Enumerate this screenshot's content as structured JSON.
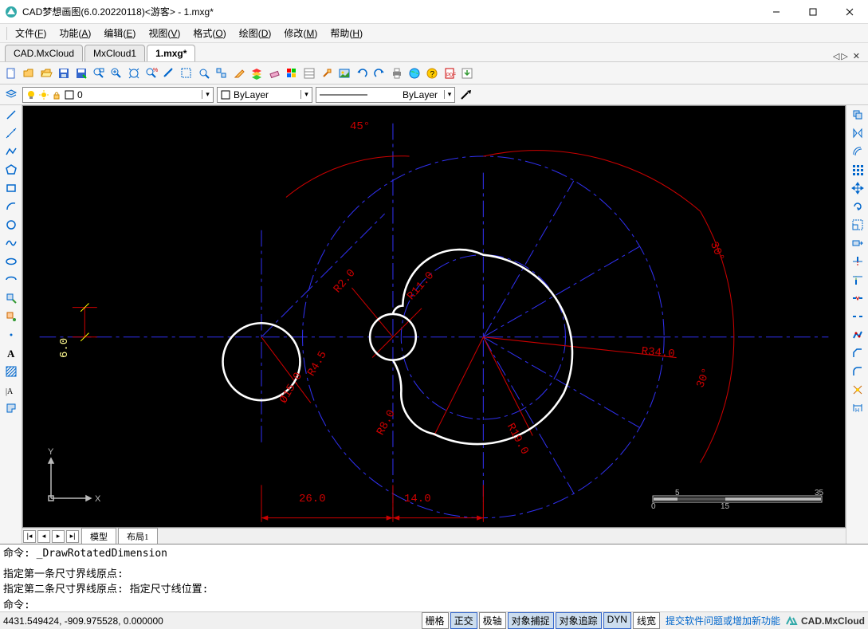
{
  "title": "CAD梦想画图(6.0.20220118)<游客> -  1.mxg*",
  "menus": [
    {
      "label": "文件",
      "key": "F"
    },
    {
      "label": "功能",
      "key": "A"
    },
    {
      "label": "编辑",
      "key": "E"
    },
    {
      "label": "视图",
      "key": "V"
    },
    {
      "label": "格式",
      "key": "O"
    },
    {
      "label": "绘图",
      "key": "D"
    },
    {
      "label": "修改",
      "key": "M"
    },
    {
      "label": "帮助",
      "key": "H"
    }
  ],
  "doctabs": [
    {
      "label": "CAD.MxCloud",
      "active": false
    },
    {
      "label": "MxCloud1",
      "active": false
    },
    {
      "label": "1.mxg*",
      "active": true
    }
  ],
  "layerbar": {
    "current_layer": "0",
    "bylayer1": "ByLayer",
    "bylayer2": "ByLayer"
  },
  "viewport_tabs": [
    "模型",
    "布局1"
  ],
  "commands": {
    "line1": "命令: _DrawRotatedDimension",
    "line2": "指定第一条尺寸界线原点:",
    "line3": "指定第二条尺寸界线原点: 指定尺寸线位置:",
    "line4": "命令:"
  },
  "status": {
    "coords": "4431.549424, -909.975528,  0.000000",
    "buttons": [
      {
        "label": "栅格",
        "active": false
      },
      {
        "label": "正交",
        "active": true
      },
      {
        "label": "极轴",
        "active": false
      },
      {
        "label": "对象捕捉",
        "active": true
      },
      {
        "label": "对象追踪",
        "active": true
      },
      {
        "label": "DYN",
        "active": true
      },
      {
        "label": "线宽",
        "active": false
      }
    ],
    "link": "提交软件问题或增加新功能",
    "brand": "CAD.MxCloud"
  },
  "drawing": {
    "angle_top": "45°",
    "angle_right_top": "30°",
    "angle_right_bottom": "30°",
    "r2": "R2.0",
    "r11": "R11.0",
    "r4_5": "R4.5",
    "phi15": "Ø15.0",
    "r8": "R8.0",
    "r19": "R19.0",
    "r34": "R34.0",
    "dim26": "26.0",
    "dim14": "14.0",
    "dim6": "6.0",
    "ucs_x": "X",
    "ucs_y": "Y",
    "scale": {
      "a": "0",
      "b": "5",
      "c": "15",
      "d": "35"
    }
  }
}
